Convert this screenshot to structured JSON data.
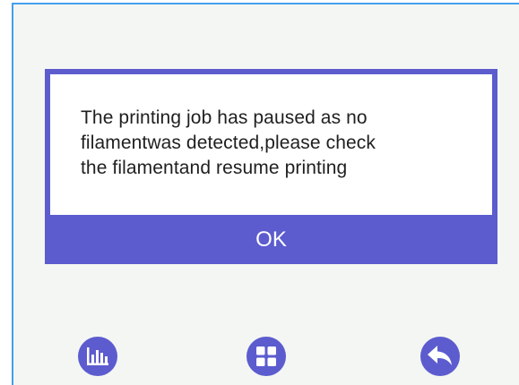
{
  "colors": {
    "accent": "#5c5ccf",
    "screen_background": "#f4f6f3",
    "screen_border": "#43a0ec",
    "dialog_body": "#ffffff",
    "message_text": "#1f1f1f",
    "button_text": "#ffffff"
  },
  "dialog": {
    "message": "The printing job has paused as no\nfilamentwas detected,please check\nthe filamentand resume printing",
    "ok_label": "OK"
  },
  "bottom_nav": [
    {
      "icon": "bar-chart-icon"
    },
    {
      "icon": "grid-icon"
    },
    {
      "icon": "back-arrow-icon"
    }
  ]
}
